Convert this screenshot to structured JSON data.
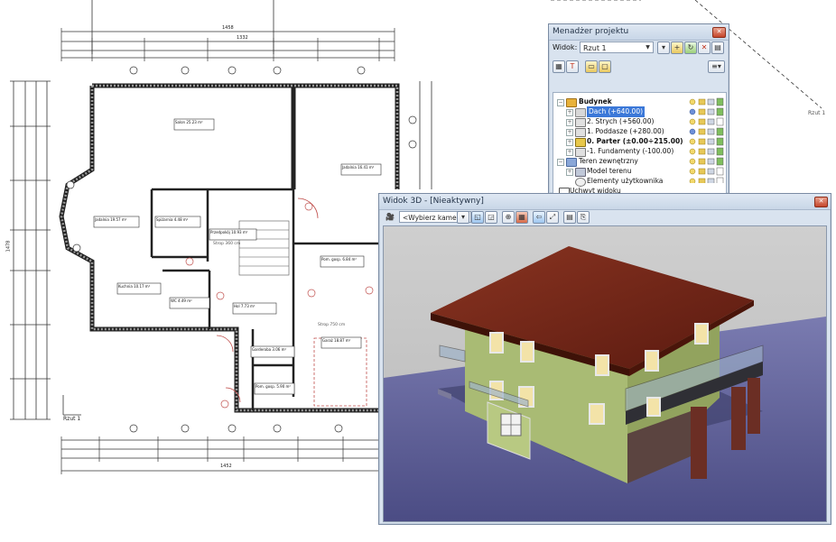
{
  "project_manager": {
    "title": "Menadżer projektu",
    "view_label": "Widok:",
    "view_value": "Rzut 1",
    "tree": [
      {
        "label": "Budynek",
        "level": 0
      },
      {
        "label": "Dach (+640.00)",
        "level": 1,
        "selected": true
      },
      {
        "label": "2. Strych (+560.00)",
        "level": 1
      },
      {
        "label": "1. Poddasze (+280.00)",
        "level": 1
      },
      {
        "label": "0. Parter (±0.00÷215.00)",
        "level": 1,
        "bold": true
      },
      {
        "label": "-1. Fundamenty (-100.00)",
        "level": 1
      },
      {
        "label": "Teren zewnętrzny",
        "level": 0
      },
      {
        "label": "Model terenu",
        "level": 1
      },
      {
        "label": "Elementy użytkownika",
        "level": 1
      },
      {
        "label": "Uchwyt widoku",
        "level": 0
      }
    ]
  },
  "view3d": {
    "title": "Widok 3D - [Nieaktywny]",
    "camera_placeholder": "<Wybierz kamerę>"
  },
  "plan": {
    "label_rzut": "Rzut 1",
    "dim_top": "1458",
    "dim_top2": "1332",
    "dim_bottom": "1452",
    "dim_left": "1478",
    "right_label": "Rzut 1",
    "rooms": [
      {
        "name": "Salon",
        "num": "4",
        "area": "25.23 m²",
        "floor": "Parkiet"
      },
      {
        "name": "Jadalnia",
        "num": "5",
        "area": "16.41 m²",
        "floor": "Parkiet"
      },
      {
        "name": "Jadalnia",
        "num": "10",
        "area": "19.57 m²",
        "floor": "Parkiet"
      },
      {
        "name": "Spiżarnia",
        "num": "11",
        "area": "4.48 m²",
        "floor": "Terakota"
      },
      {
        "name": "Przedpokój",
        "num": "8",
        "area": "10.93 m²",
        "floor": "Terakota"
      },
      {
        "name": "Kuchnia",
        "num": "11",
        "area": "10.17 m²",
        "floor": "Terakota"
      },
      {
        "name": "WC",
        "num": "8",
        "area": "4.49 m²",
        "floor": "Terakota"
      },
      {
        "name": "Hol",
        "num": "5",
        "area": "7.73 m²",
        "floor": "Terakota"
      },
      {
        "name": "Pom. gosp.",
        "num": "3",
        "area": "6.84 m²",
        "floor": "Parkiet"
      },
      {
        "name": "Garderoba",
        "num": "2",
        "area": "3.06 m²",
        "floor": "Terakota"
      },
      {
        "name": "Pom. gosp.",
        "num": "1",
        "area": "5.90 m²",
        "floor": "Grès"
      },
      {
        "name": "Garaż",
        "num": "4",
        "area": "18.87 m²",
        "floor": "Grès"
      }
    ],
    "stair_note": "Strop 360 cm",
    "stair_note2": "Strop 750 cm"
  },
  "colors": {
    "accent": "#3b78d8",
    "wall_green": "#a8bf74",
    "roof": "#6b2316",
    "ground": "#5e5f94",
    "sky": "#c3c3c3"
  }
}
